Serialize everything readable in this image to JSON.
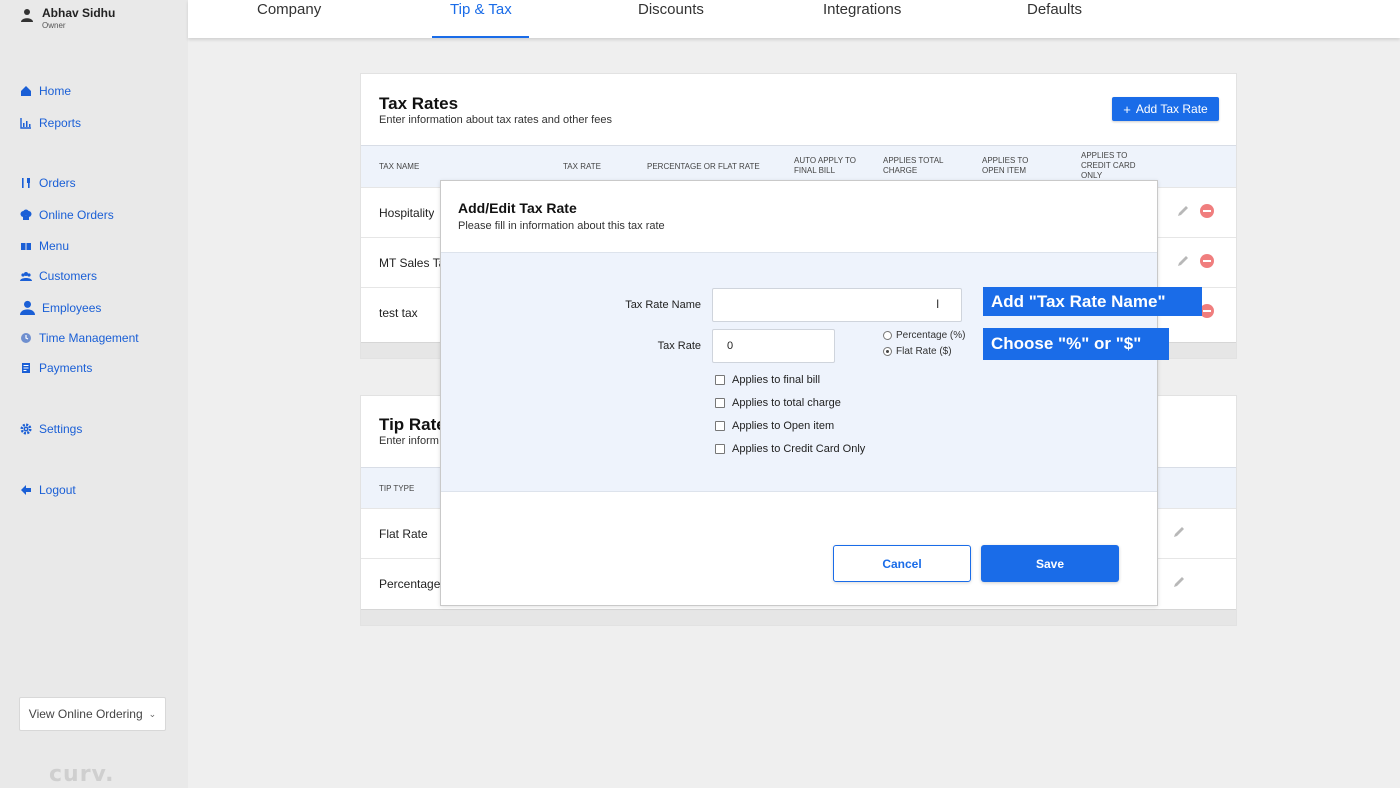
{
  "user": {
    "name": "Abhav Sidhu",
    "role": "Owner"
  },
  "sidebar": {
    "items": [
      {
        "label": "Home",
        "icon": "home-icon"
      },
      {
        "label": "Reports",
        "icon": "chart-icon"
      },
      {
        "label": "Orders",
        "icon": "utensils-icon"
      },
      {
        "label": "Online Orders",
        "icon": "chef-hat-icon"
      },
      {
        "label": "Menu",
        "icon": "book-icon"
      },
      {
        "label": "Customers",
        "icon": "group-icon"
      },
      {
        "label": "Employees",
        "icon": "person-icon"
      },
      {
        "label": "Time Management",
        "icon": "clock-icon"
      },
      {
        "label": "Payments",
        "icon": "receipt-icon"
      },
      {
        "label": "Settings",
        "icon": "gear-icon"
      },
      {
        "label": "Logout",
        "icon": "arrow-left-icon"
      }
    ],
    "view_online_label": "View Online Ordering",
    "brand": "curv."
  },
  "tabs": [
    "Company",
    "Tip & Tax",
    "Discounts",
    "Integrations",
    "Defaults"
  ],
  "active_tab": "Tip & Tax",
  "tax_rates": {
    "title": "Tax Rates",
    "subtitle": "Enter information about tax rates and other fees",
    "add_label": "Add Tax Rate",
    "columns": [
      "TAX NAME",
      "TAX RATE",
      "PERCENTAGE OR FLAT RATE",
      "AUTO APPLY TO FINAL BILL",
      "APPLIES TOTAL CHARGE",
      "APPLIES TO OPEN ITEM",
      "APPLIES TO CREDIT CARD ONLY"
    ],
    "rows": [
      "Hospitality",
      "MT Sales Ta",
      "test tax"
    ]
  },
  "tip_rates": {
    "title": "Tip Rate",
    "subtitle": "Enter inform",
    "columns": [
      "TIP TYPE"
    ],
    "rows": [
      "Flat Rate",
      "Percentage"
    ]
  },
  "modal": {
    "title": "Add/Edit Tax Rate",
    "subtitle": "Please fill in information about this tax rate",
    "name_label": "Tax Rate Name",
    "name_value": "",
    "rate_label": "Tax Rate",
    "rate_value": "0",
    "radio_percentage": "Percentage (%)",
    "radio_flat": "Flat Rate ($)",
    "selected_radio": "Flat Rate ($)",
    "checkboxes": [
      "Applies to final bill",
      "Applies to total charge",
      "Applies to Open item",
      "Applies to Credit Card Only"
    ],
    "cancel_label": "Cancel",
    "save_label": "Save"
  },
  "callouts": {
    "name": "Add \"Tax Rate Name\"",
    "choose": "Choose \"%\" or \"$\""
  },
  "colors": {
    "accent": "#1a6ce8",
    "danger": "#f07e7e"
  }
}
